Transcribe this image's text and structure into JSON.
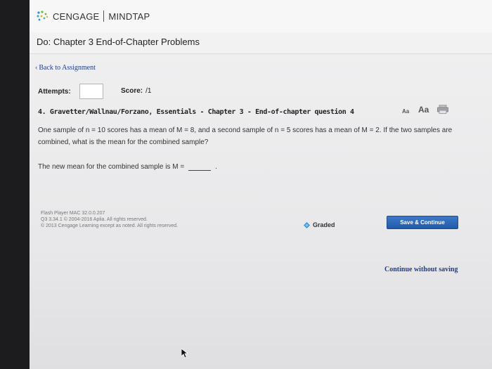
{
  "header": {
    "brand": "CENGAGE",
    "product": "MINDTAP",
    "brand_colors": [
      "#2b8fd6",
      "#6dbb45",
      "#f2a72a",
      "#3bb3c3"
    ]
  },
  "page": {
    "title": "Do: Chapter 3 End-of-Chapter Problems"
  },
  "nav": {
    "back_label": "Back to Assignment"
  },
  "status": {
    "attempts_label": "Attempts:",
    "attempts_value": "",
    "score_label": "Score:",
    "score_value": "/1"
  },
  "question": {
    "number": "4.",
    "heading": "Gravetter/Wallnau/Forzano, Essentials - Chapter 3 - End-of-chapter question 4",
    "text_size_small": "Aa",
    "text_size_large": "Aa",
    "body": "One sample of n = 10 scores has a mean of M = 8, and a second sample of n = 5 scores has a mean of M = 2. If the two samples are combined, what is the mean for the combined sample?",
    "prompt": "The new mean for the combined sample is M =",
    "answer_value": "",
    "prompt_suffix": "."
  },
  "footer": {
    "credits": [
      "Flash Player MAC 32.0.0.207",
      "Q3 3.34.1 © 2004-2016 Aplia. All rights reserved.",
      "© 2013 Cengage Learning except as noted. All rights reserved."
    ],
    "graded_label": "Graded",
    "save_button": "Save & Continue",
    "continue_link": "Continue without saving"
  }
}
